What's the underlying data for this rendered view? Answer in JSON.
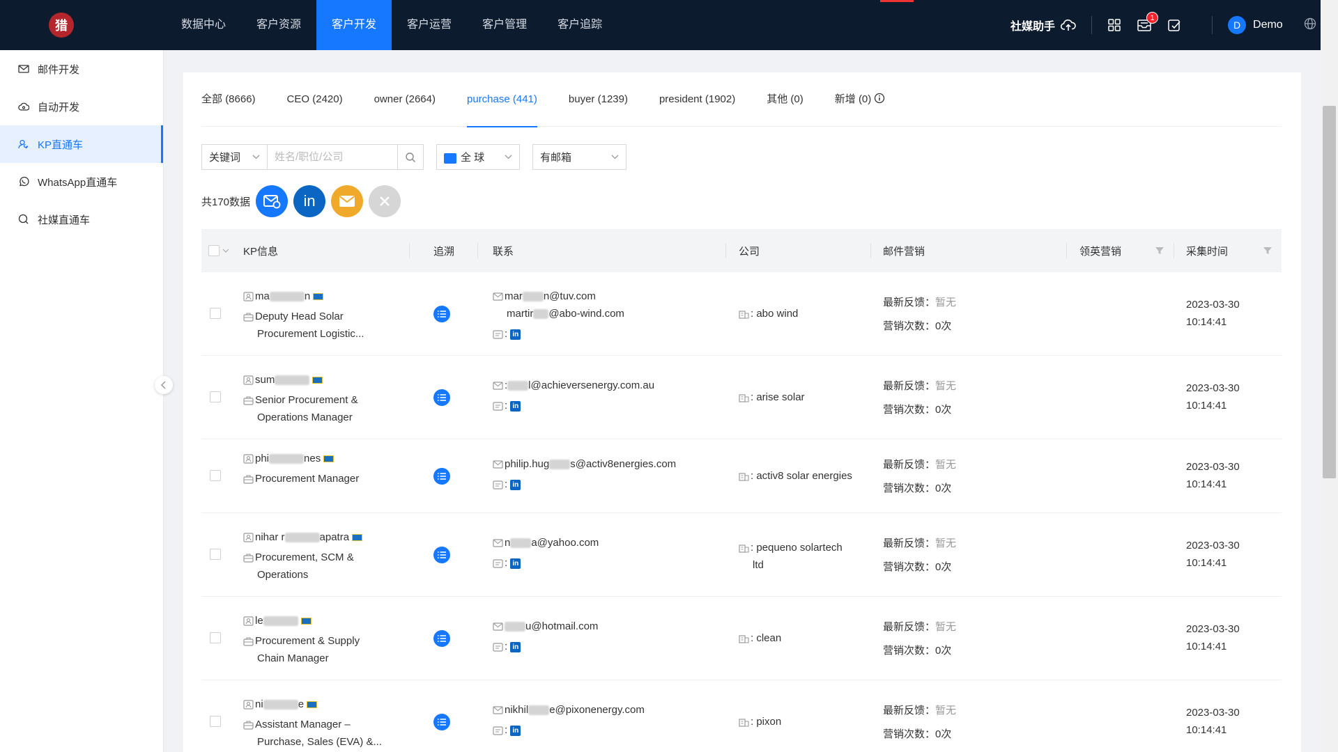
{
  "nav": {
    "logo": "猎",
    "items": [
      "数据中心",
      "客户资源",
      "客户开发",
      "客户运营",
      "客户管理",
      "客户追踪"
    ],
    "active_index": 2
  },
  "topright": {
    "social_label": "社媒助手",
    "badge_count": "1",
    "user_initial": "D",
    "user_name": "Demo"
  },
  "sidebar": {
    "items": [
      "邮件开发",
      "自动开发",
      "KP直通车",
      "WhatsApp直通车",
      "社媒直通车"
    ],
    "active_index": 2
  },
  "tabs": [
    {
      "label": "全部",
      "count": "(8666)"
    },
    {
      "label": "CEO",
      "count": "(2420)"
    },
    {
      "label": "owner",
      "count": "(2664)"
    },
    {
      "label": "purchase",
      "count": "(441)"
    },
    {
      "label": "buyer",
      "count": "(1239)"
    },
    {
      "label": "president",
      "count": "(1902)"
    },
    {
      "label": "其他",
      "count": "(0)"
    },
    {
      "label": "新增",
      "count": "(0)"
    }
  ],
  "active_tab": 3,
  "filters": {
    "keyword_select": "关键词",
    "keyword_placeholder": "姓名/职位/公司",
    "region": "全 球",
    "email_filter": "有邮箱"
  },
  "total": "共170数据",
  "table": {
    "headers": [
      "KP信息",
      "追溯",
      "联系",
      "公司",
      "邮件营销",
      "领英营销",
      "采集时间"
    ],
    "feedback_label": "最新反馈：",
    "feedback_value": "暂无",
    "count_label": "营销次数：",
    "count_value": "0次",
    "rows": [
      {
        "name_a": "ma",
        "name_b": "n",
        "title1": "Deputy Head Solar",
        "title2": "Procurement Logistic...",
        "email1a": "mar",
        "email1b": "n@tuv.com",
        "email2a": "martir",
        "email2b": "@abo-wind.com",
        "company1": ": abo wind",
        "company2": "",
        "date": "2023-03-30",
        "time": "10:14:41"
      },
      {
        "name_a": "sum",
        "name_b": "",
        "title1": "Senior Procurement &",
        "title2": "Operations Manager",
        "email1a": ":",
        "email1b": "l@achieversenergy.com.au",
        "email2a": "",
        "email2b": "",
        "company1": ": arise solar",
        "company2": "",
        "date": "2023-03-30",
        "time": "10:14:41"
      },
      {
        "name_a": "phi",
        "name_b": "nes",
        "title1": "Procurement Manager",
        "title2": "",
        "email1a": "philip.hug",
        "email1b": "s@activ8energies.com",
        "email2a": "",
        "email2b": "",
        "company1": ": activ8 solar energies",
        "company2": "",
        "date": "2023-03-30",
        "time": "10:14:41"
      },
      {
        "name_a": "nihar r",
        "name_b": "apatra",
        "title1": "Procurement, SCM &",
        "title2": "Operations",
        "email1a": "n",
        "email1b": "a@yahoo.com",
        "email2a": "",
        "email2b": "",
        "company1": ": pequeno solartech",
        "company2": "ltd",
        "date": "2023-03-30",
        "time": "10:14:41"
      },
      {
        "name_a": "le",
        "name_b": "",
        "title1": "Procurement & Supply",
        "title2": "Chain Manager",
        "email1a": "",
        "email1b": "u@hotmail.com",
        "email2a": "",
        "email2b": "",
        "company1": ": clean",
        "company2": "",
        "date": "2023-03-30",
        "time": "10:14:41"
      },
      {
        "name_a": "ni",
        "name_b": "e",
        "title1": "Assistant Manager –",
        "title2": "Purchase, Sales (EVA) &...",
        "email1a": "nikhil",
        "email1b": "e@pixonenergy.com",
        "email2a": "",
        "email2b": "",
        "company1": ": pixon",
        "company2": "",
        "date": "2023-03-30",
        "time": "10:14:41"
      }
    ]
  },
  "colors": {
    "nav_bg": "#0d1b2e",
    "accent": "#1677ff",
    "badge": "#f5222d",
    "email_btn": "#f0a92a",
    "linkedin": "#0a66c2"
  },
  "icons": {
    "social": "cloud-upload-icon",
    "apps": "grid-icon",
    "messages": "inbox-icon",
    "tasks": "edit-icon",
    "language": "globe-icon"
  }
}
